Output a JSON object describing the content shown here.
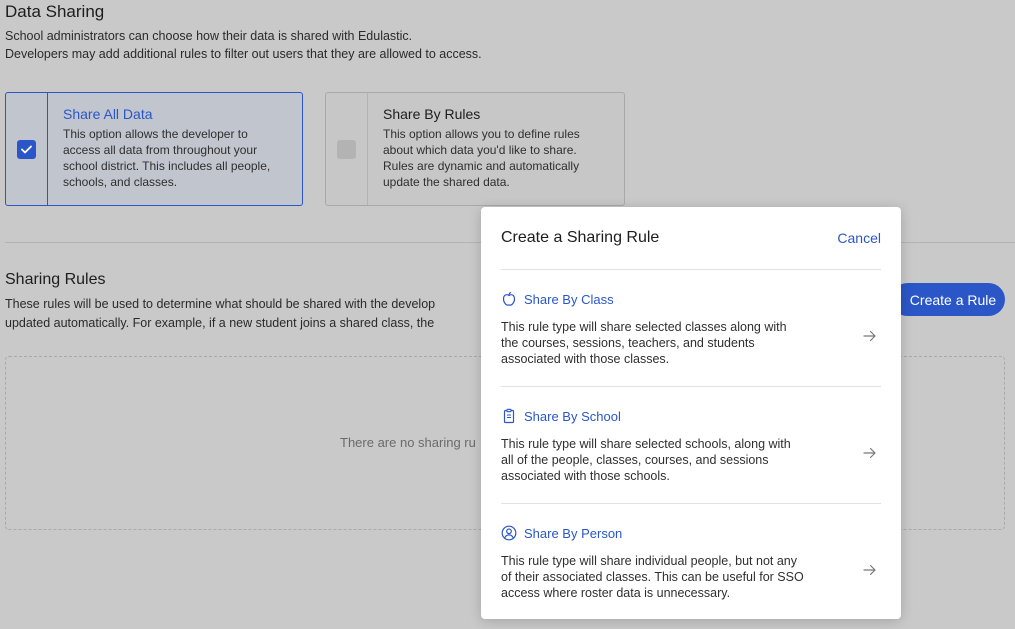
{
  "data_sharing": {
    "title": "Data Sharing",
    "desc_line1": "School administrators can choose how their data is shared with Edulastic.",
    "desc_line2": "Developers may add additional rules to filter out users that they are allowed to access."
  },
  "options": [
    {
      "title": "Share All Data",
      "selected": true,
      "lines": [
        "This option allows the developer to",
        "access all data from throughout your",
        "school district. This includes all people,",
        "schools, and classes."
      ]
    },
    {
      "title": "Share By Rules",
      "selected": false,
      "lines": [
        "This option allows you to define rules",
        "about which data you'd like to share.",
        "Rules are dynamic and automatically",
        "update the shared data."
      ]
    }
  ],
  "sharing_rules": {
    "title": "Sharing Rules",
    "desc_line1": "These rules will be used to determine what should be shared with the develop",
    "desc_line2": "updated automatically. For example, if a new student joins a shared class, the",
    "create_button": "Create a Rule",
    "empty_text": "There are no sharing ru"
  },
  "modal": {
    "title": "Create a Sharing Rule",
    "cancel": "Cancel",
    "rules": [
      {
        "label": "Share By Class",
        "icon": "apple-icon",
        "lines": [
          "This rule type will share selected classes along with",
          "the courses, sessions, teachers, and students",
          "associated with those classes."
        ]
      },
      {
        "label": "Share By School",
        "icon": "clipboard-icon",
        "lines": [
          "This rule type will share selected schools, along with",
          "all of the people, classes, courses, and sessions",
          "associated with those schools."
        ]
      },
      {
        "label": "Share By Person",
        "icon": "person-circle-icon",
        "lines": [
          "This rule type will share individual people, but not any",
          "of their associated classes. This can be useful for SSO",
          "access where roster data is unnecessary."
        ]
      }
    ]
  },
  "colors": {
    "accent": "#2b56c7",
    "overlay_bg": "#c9c9c9"
  }
}
